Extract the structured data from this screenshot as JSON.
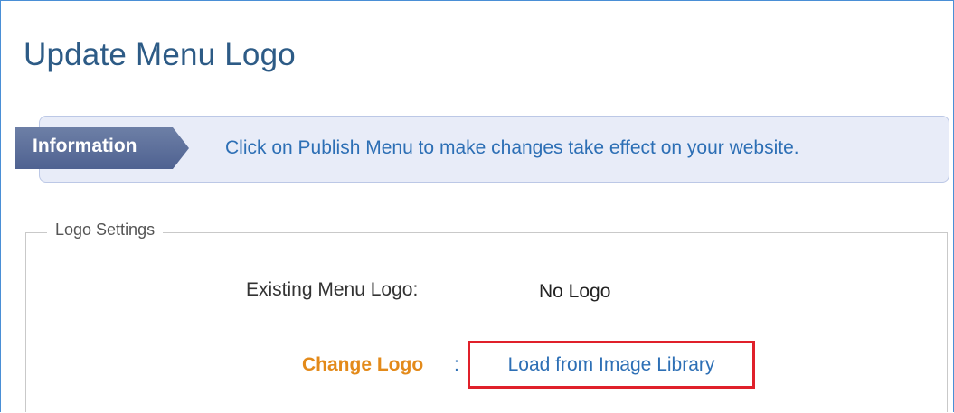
{
  "page": {
    "title": "Update Menu Logo"
  },
  "info_bar": {
    "tag_label": "Information",
    "message": "Click on Publish Menu to make changes take effect on your website."
  },
  "logo_settings": {
    "legend": "Logo Settings",
    "existing_label": "Existing Menu Logo:",
    "existing_value": "No Logo",
    "change_label": "Change Logo",
    "change_separator": ":",
    "load_link": "Load from Image Library"
  },
  "colors": {
    "title": "#2d5b86",
    "link": "#2d6fb5",
    "change_label": "#e38a1a",
    "highlight_border": "#e0202a",
    "info_bar_bg": "#e8ecf8"
  }
}
